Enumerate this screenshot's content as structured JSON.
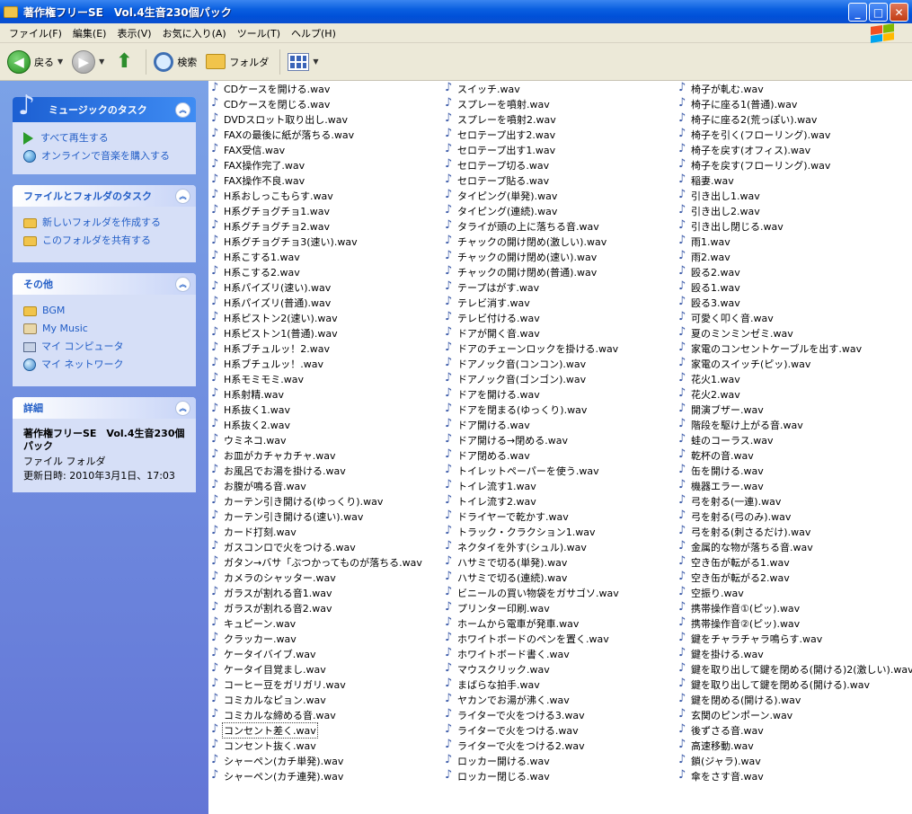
{
  "window": {
    "title": "著作権フリーSE　Vol.4生音230個パック"
  },
  "menubar": [
    "ファイル(F)",
    "編集(E)",
    "表示(V)",
    "お気に入り(A)",
    "ツール(T)",
    "ヘルプ(H)"
  ],
  "toolbar": {
    "back_label": "戻る",
    "search_label": "検索",
    "folders_label": "フォルダ"
  },
  "sidebar": {
    "music_tasks": {
      "title": "ミュージックのタスク",
      "items": [
        "すべて再生する",
        "オンラインで音楽を購入する"
      ]
    },
    "file_tasks": {
      "title": "ファイルとフォルダのタスク",
      "items": [
        "新しいフォルダを作成する",
        "このフォルダを共有する"
      ]
    },
    "other_places": {
      "title": "その他",
      "items": [
        "BGM",
        "My Music",
        "マイ コンピュータ",
        "マイ ネットワーク"
      ]
    },
    "details": {
      "title": "詳細",
      "name": "著作権フリーSE　Vol.4生音230個パック",
      "type": "ファイル フォルダ",
      "modified": "更新日時: 2010年3月1日、17:03"
    }
  },
  "files": {
    "col0": [
      "CDケースを開ける.wav",
      "CDケースを閉じる.wav",
      "DVDスロット取り出し.wav",
      "FAXの最後に紙が落ちる.wav",
      "FAX受信.wav",
      "FAX操作完了.wav",
      "FAX操作不良.wav",
      "H系おしっこもらす.wav",
      "H系グチョグチョ1.wav",
      "H系グチョグチョ2.wav",
      "H系グチョグチョ3(速い).wav",
      "H系こする1.wav",
      "H系こする2.wav",
      "H系パイズリ(速い).wav",
      "H系パイズリ(普通).wav",
      "H系ピストン2(速い).wav",
      "H系ピストン1(普通).wav",
      "H系ブチュルッ！2.wav",
      "H系ブチュルッ！.wav",
      "H系モミモミ.wav",
      "H系射精.wav",
      "H系抜く1.wav",
      "H系抜く2.wav",
      "ウミネコ.wav",
      "お皿がカチャカチャ.wav",
      "お風呂でお湯を掛ける.wav",
      "お腹が鳴る音.wav",
      "カーテン引き開ける(ゆっくり).wav",
      "カーテン引き開ける(速い).wav",
      "カード打刻.wav",
      "ガスコンロで火をつける.wav",
      "ガタン→バサ「ぶつかってものが落ちる.wav",
      "カメラのシャッター.wav",
      "ガラスが割れる音1.wav",
      "ガラスが割れる音2.wav",
      "キュピーン.wav",
      "クラッカー.wav",
      "ケータイバイブ.wav",
      "ケータイ目覚まし.wav",
      "コーヒー豆をガリガリ.wav",
      "コミカルなピョン.wav",
      "コミカルな締める音.wav",
      "コンセント差く.wav",
      "コンセント抜く.wav",
      "シャーペン(カチ単発).wav",
      "シャーペン(カチ連発).wav"
    ],
    "col1": [
      "スイッチ.wav",
      "スプレーを噴射.wav",
      "スプレーを噴射2.wav",
      "セロテープ出す2.wav",
      "セロテープ出す1.wav",
      "セロテープ切る.wav",
      "セロテープ貼る.wav",
      "タイピング(単発).wav",
      "タイピング(連続).wav",
      "タライが頭の上に落ちる音.wav",
      "チャックの開け閉め(激しい).wav",
      "チャックの開け閉め(速い).wav",
      "チャックの開け閉め(普通).wav",
      "テープはがす.wav",
      "テレビ消す.wav",
      "テレビ付ける.wav",
      "ドアが開く音.wav",
      "ドアのチェーンロックを掛ける.wav",
      "ドアノック音(コンコン).wav",
      "ドアノック音(ゴンゴン).wav",
      "ドアを開ける.wav",
      "ドアを閉まる(ゆっくり).wav",
      "ドア開ける.wav",
      "ドア開ける→閉める.wav",
      "ドア閉める.wav",
      "トイレットペーパーを使う.wav",
      "トイレ流す1.wav",
      "トイレ流す2.wav",
      "ドライヤーで乾かす.wav",
      "トラック・クラクション1.wav",
      "ネクタイを外す(シュル).wav",
      "ハサミで切る(単発).wav",
      "ハサミで切る(連続).wav",
      "ビニールの買い物袋をガサゴソ.wav",
      "プリンター印刷.wav",
      "ホームから電車が発車.wav",
      "ホワイトボードのペンを置く.wav",
      "ホワイトボード書く.wav",
      "マウスクリック.wav",
      "まばらな拍手.wav",
      "ヤカンでお湯が沸く.wav",
      "ライターで火をつける3.wav",
      "ライターで火をつける.wav",
      "ライターで火をつける2.wav",
      "ロッカー開ける.wav",
      "ロッカー閉じる.wav"
    ],
    "col2": [
      "椅子が軋む.wav",
      "椅子に座る1(普通).wav",
      "椅子に座る2(荒っぽい).wav",
      "椅子を引く(フローリング).wav",
      "椅子を戻す(オフィス).wav",
      "椅子を戻す(フローリング).wav",
      "稲妻.wav",
      "引き出し1.wav",
      "引き出し2.wav",
      "引き出し閉じる.wav",
      "雨1.wav",
      "雨2.wav",
      "殴る2.wav",
      "殴る1.wav",
      "殴る3.wav",
      "可愛く叩く音.wav",
      "夏のミンミンゼミ.wav",
      "家電のコンセントケーブルを出す.wav",
      "家電のスイッチ(ピッ).wav",
      "花火1.wav",
      "花火2.wav",
      "開演ブザー.wav",
      "階段を駆け上がる音.wav",
      "蛙のコーラス.wav",
      "乾杯の音.wav",
      "缶を開ける.wav",
      "機器エラー.wav",
      "弓を射る(一連).wav",
      "弓を射る(弓のみ).wav",
      "弓を射る(刺さるだけ).wav",
      "金属的な物が落ちる音.wav",
      "空き缶が転がる1.wav",
      "空き缶が転がる2.wav",
      "空振り.wav",
      "携帯操作音①(ピッ).wav",
      "携帯操作音②(ピッ).wav",
      "鍵をチャラチャラ鳴らす.wav",
      "鍵を掛ける.wav",
      "鍵を取り出して鍵を閉める(開ける)2(激しい).wav",
      "鍵を取り出して鍵を閉める(開ける).wav",
      "鍵を閉める(開ける).wav",
      "玄関のピンポーン.wav",
      "後ずさる音.wav",
      "高速移動.wav",
      "鎖(ジャラ).wav",
      "傘をさす音.wav"
    ]
  }
}
